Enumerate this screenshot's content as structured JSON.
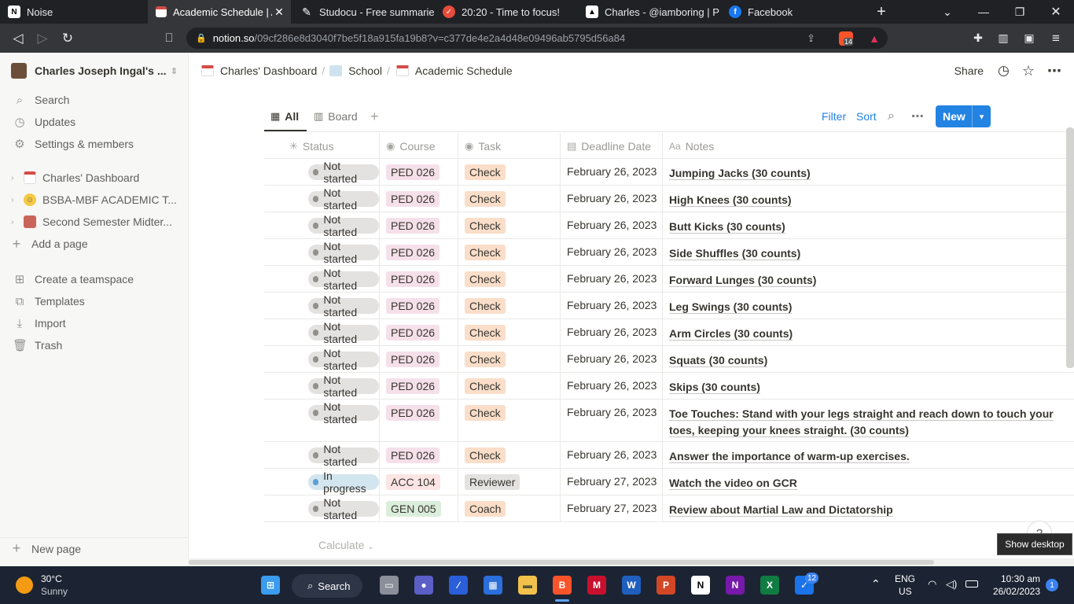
{
  "browser": {
    "tabs": [
      {
        "title": "Noise",
        "favicon": "N",
        "active": false
      },
      {
        "title": "Academic Schedule | Al",
        "favicon": "cal",
        "active": true
      },
      {
        "title": "Studocu - Free summaries,",
        "favicon": "S",
        "active": false
      },
      {
        "title": "20:20 - Time to focus!",
        "favicon": "check",
        "active": false
      },
      {
        "title": "Charles - @iamboring | Pea",
        "favicon": "A",
        "active": false
      },
      {
        "title": "Facebook",
        "favicon": "f",
        "active": false
      }
    ],
    "url_host": "notion.so",
    "url_path": "/09cf286e8d3040f7be5f18a915fa19b8?v=c377de4e2a4d48e09496ab5795d56a84",
    "brave_badge": "14"
  },
  "sidebar": {
    "workspace": "Charles Joseph Ingal's ...",
    "nav": [
      "Search",
      "Updates",
      "Settings & members"
    ],
    "pages": [
      "Charles' Dashboard",
      "BSBA-MBF ACADEMIC T...",
      "Second Semester Midter..."
    ],
    "add_page": "Add a page",
    "bottom": [
      "Create a teamspace",
      "Templates",
      "Import",
      "Trash"
    ],
    "new_page": "New page"
  },
  "topbar": {
    "breadcrumbs": [
      "Charles' Dashboard",
      "School",
      "Academic Schedule"
    ],
    "share": "Share"
  },
  "views": {
    "all": "All",
    "board": "Board",
    "filter": "Filter",
    "sort": "Sort",
    "new": "New"
  },
  "table": {
    "columns": [
      "Status",
      "Course",
      "Task",
      "Deadline Date",
      "Notes"
    ],
    "rows": [
      {
        "status": "Not started",
        "course": "PED 026",
        "task": "Check",
        "date": "February 26, 2023",
        "notes": "Jumping Jacks (30 counts)"
      },
      {
        "status": "Not started",
        "course": "PED 026",
        "task": "Check",
        "date": "February 26, 2023",
        "notes": "High Knees (30 counts)"
      },
      {
        "status": "Not started",
        "course": "PED 026",
        "task": "Check",
        "date": "February 26, 2023",
        "notes": "Butt Kicks (30 counts)"
      },
      {
        "status": "Not started",
        "course": "PED 026",
        "task": "Check",
        "date": "February 26, 2023",
        "notes": "Side Shuffles (30 counts)"
      },
      {
        "status": "Not started",
        "course": "PED 026",
        "task": "Check",
        "date": "February 26, 2023",
        "notes": "Forward Lunges (30 counts)"
      },
      {
        "status": "Not started",
        "course": "PED 026",
        "task": "Check",
        "date": "February 26, 2023",
        "notes": "Leg Swings (30 counts)"
      },
      {
        "status": "Not started",
        "course": "PED 026",
        "task": "Check",
        "date": "February 26, 2023",
        "notes": "Arm Circles (30 counts)"
      },
      {
        "status": "Not started",
        "course": "PED 026",
        "task": "Check",
        "date": "February 26, 2023",
        "notes": "Squats (30 counts)"
      },
      {
        "status": "Not started",
        "course": "PED 026",
        "task": "Check",
        "date": "February 26, 2023",
        "notes": "Skips (30 counts)"
      },
      {
        "status": "Not started",
        "course": "PED 026",
        "task": "Check",
        "date": "February 26, 2023",
        "notes": "Toe Touches: Stand with your legs straight and reach down to touch your toes, keeping your knees straight. (30 counts)"
      },
      {
        "status": "Not started",
        "course": "PED 026",
        "task": "Check",
        "date": "February 26, 2023",
        "notes": "Answer the importance of warm-up exercises."
      },
      {
        "status": "In progress",
        "course": "ACC 104",
        "task": "Reviewer",
        "date": "February 27, 2023",
        "notes": "Watch the video on GCR"
      },
      {
        "status": "Not started",
        "course": "GEN 005",
        "task": "Coach",
        "date": "February 27, 2023",
        "notes": "Review about Martial Law and Dictatorship"
      }
    ],
    "calculate": "Calculate"
  },
  "tooltip": "Show desktop",
  "taskbar": {
    "weather_temp": "30°C",
    "weather_desc": "Sunny",
    "search": "Search",
    "lang": "ENG",
    "region": "US",
    "time": "10:30 am",
    "date": "26/02/2023",
    "notif": "1",
    "todo_badge": "12"
  },
  "colors": {
    "accent": "#2383e2",
    "ped_tag": "#f5e0e9",
    "acc_tag": "#fbe4e4",
    "gen_tag": "#dbeddb",
    "check_tag": "#fadec9",
    "reviewer_tag": "#e3e2e0",
    "coach_tag": "#fadec9"
  }
}
